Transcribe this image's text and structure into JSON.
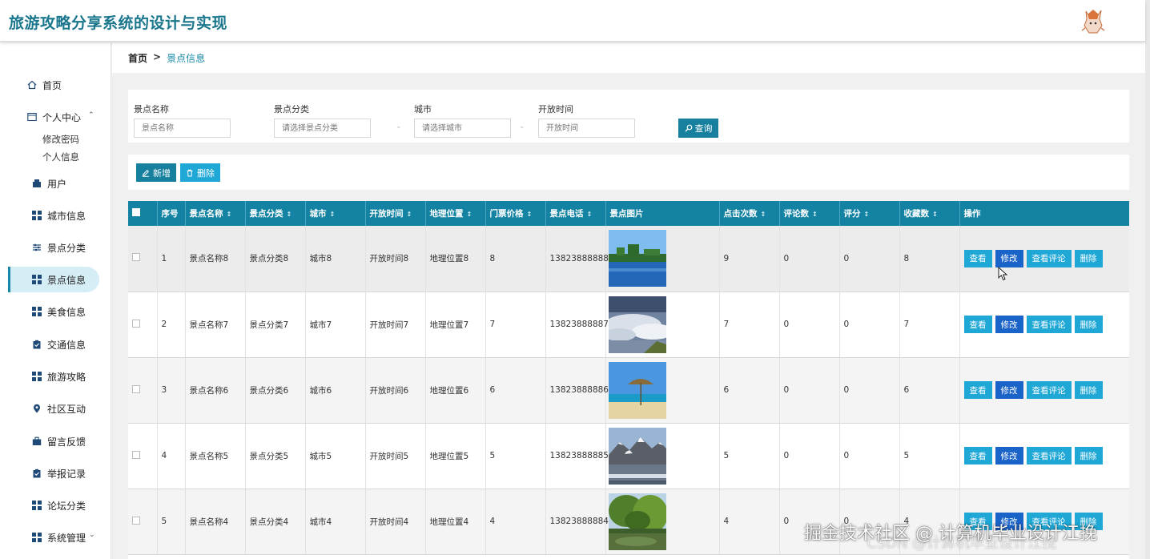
{
  "app": {
    "title": "旅游攻略分享系统的设计与实现"
  },
  "sidebar": {
    "home": "首页",
    "personal": {
      "label": "个人中心",
      "children": [
        "修改密码",
        "个人信息"
      ]
    },
    "items": [
      "用户",
      "城市信息",
      "景点分类",
      "景点信息",
      "美食信息",
      "交通信息",
      "旅游攻略",
      "社区互动",
      "留言反馈",
      "举报记录",
      "论坛分类",
      "系统管理"
    ],
    "active": "景点信息"
  },
  "breadcrumb": {
    "home": "首页",
    "separator": ">",
    "current": "景点信息"
  },
  "search": {
    "fields": [
      {
        "label": "景点名称",
        "placeholder": "景点名称"
      },
      {
        "label": "景点分类",
        "placeholder": "请选择景点分类"
      },
      {
        "label": "城市",
        "placeholder": "请选择城市"
      },
      {
        "label": "开放时间",
        "placeholder": "开放时间"
      }
    ],
    "query_label": "查询"
  },
  "actions": {
    "add_label": "新增",
    "delete_label": "删除"
  },
  "table": {
    "headers": [
      "序号",
      "景点名称",
      "景点分类",
      "城市",
      "开放时间",
      "地理位置",
      "门票价格",
      "景点电话",
      "景点图片",
      "点击次数",
      "评论数",
      "评分",
      "收藏数",
      "操作"
    ],
    "row_buttons": {
      "view": "查看",
      "edit": "修改",
      "reviews": "查看评论",
      "delete": "删除"
    },
    "rows": [
      {
        "index": "1",
        "name": "景点名称8",
        "category": "景点分类8",
        "city": "城市8",
        "open_time": "开放时间8",
        "location": "地理位置8",
        "price": "8",
        "phone": "13823888888",
        "image": "lake-with-trees",
        "clicks": "9",
        "comments": "0",
        "rating": "0",
        "favorites": "8"
      },
      {
        "index": "2",
        "name": "景点名称7",
        "category": "景点分类7",
        "city": "城市7",
        "open_time": "开放时间7",
        "location": "地理位置7",
        "price": "7",
        "phone": "13823888887",
        "image": "sea-of-clouds",
        "clicks": "7",
        "comments": "0",
        "rating": "0",
        "favorites": "7"
      },
      {
        "index": "3",
        "name": "景点名称6",
        "category": "景点分类6",
        "city": "城市6",
        "open_time": "开放时间6",
        "location": "地理位置6",
        "price": "6",
        "phone": "13823888886",
        "image": "beach-umbrella",
        "clicks": "6",
        "comments": "0",
        "rating": "0",
        "favorites": "6"
      },
      {
        "index": "4",
        "name": "景点名称5",
        "category": "景点分类5",
        "city": "城市5",
        "open_time": "开放时间5",
        "location": "地理位置5",
        "price": "5",
        "phone": "13823888885",
        "image": "snowy-mountains",
        "clicks": "5",
        "comments": "0",
        "rating": "0",
        "favorites": "5"
      },
      {
        "index": "5",
        "name": "景点名称4",
        "category": "景点分类4",
        "city": "城市4",
        "open_time": "开放时间4",
        "location": "地理位置4",
        "price": "4",
        "phone": "13823888884",
        "image": "green-trees-pond",
        "clicks": "4",
        "comments": "0",
        "rating": "0",
        "favorites": "4"
      }
    ]
  },
  "watermark": {
    "text": "掘金技术社区 @ 计算机毕业设计江挽",
    "sub": "CSDN @计算机毕业设计江挽"
  },
  "colors": {
    "brand": "#19768c",
    "header_bg": "#1483a3",
    "primary_btn": "#17809f",
    "light_btn": "#1fa7d6",
    "edit_btn": "#1a63c9"
  }
}
